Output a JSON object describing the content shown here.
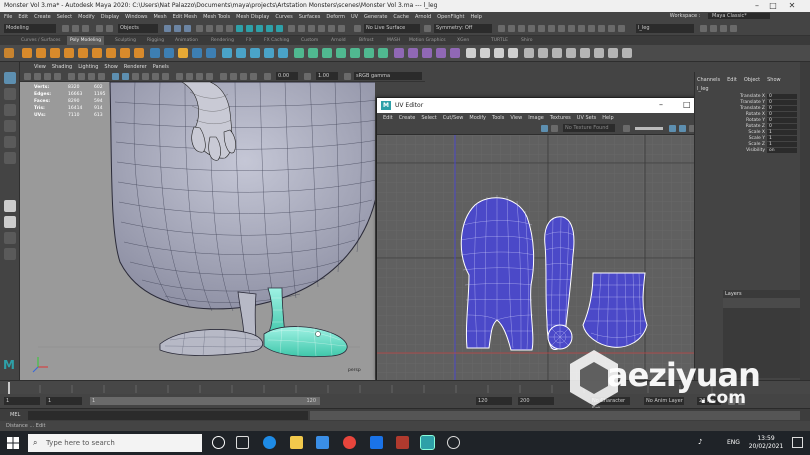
{
  "window": {
    "title": "Monster Vol 3.ma* - Autodesk Maya 2020: C:\\Users\\Nat Palazzo\\Documents\\maya\\projects\\Artstation Monsters\\scenes\\Monster Vol 3.ma  ---  l_leg"
  },
  "menubar": {
    "items": [
      "File",
      "Edit",
      "Create",
      "Select",
      "Modify",
      "Display",
      "Windows",
      "Mesh",
      "Edit Mesh",
      "Mesh Tools",
      "Mesh Display",
      "Curves",
      "Surfaces",
      "Deform",
      "UV",
      "Generate",
      "Cache",
      "Arnold",
      "OpenFlight",
      "Help"
    ],
    "workspace_label": "Workspace :",
    "workspace_value": "Maya Classic*"
  },
  "statusline": {
    "mode": "Modeling",
    "objects": "Objects",
    "live_surface": "No Live Surface",
    "symmetry": "Symmetry: Off",
    "object_name": "l_leg"
  },
  "shelf": {
    "tabs": [
      "Curves / Surfaces",
      "Poly Modeling",
      "Sculpting",
      "Rigging",
      "Animation",
      "Rendering",
      "FX",
      "FX Caching",
      "Custom",
      "Arnold",
      "Bifrost",
      "MASH",
      "Motion Graphics",
      "XGen",
      "TURTLE",
      "Shiro"
    ],
    "active_tab": "Poly Modeling"
  },
  "viewport": {
    "menu": [
      "View",
      "Shading",
      "Lighting",
      "Show",
      "Renderer",
      "Panels"
    ],
    "exposure": "0.00",
    "gamma": "1.00",
    "colorspace": "sRGB gamma",
    "hud": [
      {
        "label": "Verts:",
        "v1": "8320",
        "v2": "602"
      },
      {
        "label": "Edges:",
        "v1": "16663",
        "v2": "1195"
      },
      {
        "label": "Faces:",
        "v1": "8290",
        "v2": "594"
      },
      {
        "label": "Tris:",
        "v1": "16414",
        "v2": "914"
      },
      {
        "label": "UVs:",
        "v1": "7110",
        "v2": "613"
      }
    ],
    "camera": "persp"
  },
  "uv_editor": {
    "title": "UV Editor",
    "menu": [
      "Edit",
      "Create",
      "Select",
      "Cut/Sew",
      "Modify",
      "Tools",
      "View",
      "Image",
      "Textures",
      "UV Sets",
      "Help"
    ],
    "texture": "No Texture Found"
  },
  "channel_box": {
    "tabs": [
      "Channels",
      "Edit",
      "Object",
      "Show"
    ],
    "object": "l_leg",
    "attributes": [
      {
        "name": "Translate X",
        "value": "0"
      },
      {
        "name": "Translate Y",
        "value": "0"
      },
      {
        "name": "Translate Z",
        "value": "0"
      },
      {
        "name": "Rotate X",
        "value": "0"
      },
      {
        "name": "Rotate Y",
        "value": "0"
      },
      {
        "name": "Rotate Z",
        "value": "0"
      },
      {
        "name": "Scale X",
        "value": "1"
      },
      {
        "name": "Scale Y",
        "value": "1"
      },
      {
        "name": "Scale Z",
        "value": "1"
      },
      {
        "name": "Visibility",
        "value": "on"
      }
    ],
    "layers_label": "Layers"
  },
  "timeline": {
    "start": "1",
    "current": "1",
    "range_start": "1",
    "range_end": "120",
    "end": "120",
    "end2": "200",
    "character_set": "No Character Set",
    "anim_layer": "No Anim Layer",
    "fps": "24 fps"
  },
  "command_line": {
    "lang": "MEL",
    "help": "Distance ... Edit"
  },
  "taskbar": {
    "search_placeholder": "Type here to search",
    "lang": "ENG",
    "time": "13:59",
    "date": "20/02/2021"
  },
  "watermark": {
    "text": "aeziyuan",
    "url": ".com"
  },
  "colors": {
    "maya_accent": "#5d8fb0",
    "uv_shell_fill": "#4b49c8",
    "uv_wire": "#e8e8ff",
    "selected_mesh": "#7de3d0",
    "grid_bg": "#606060"
  }
}
